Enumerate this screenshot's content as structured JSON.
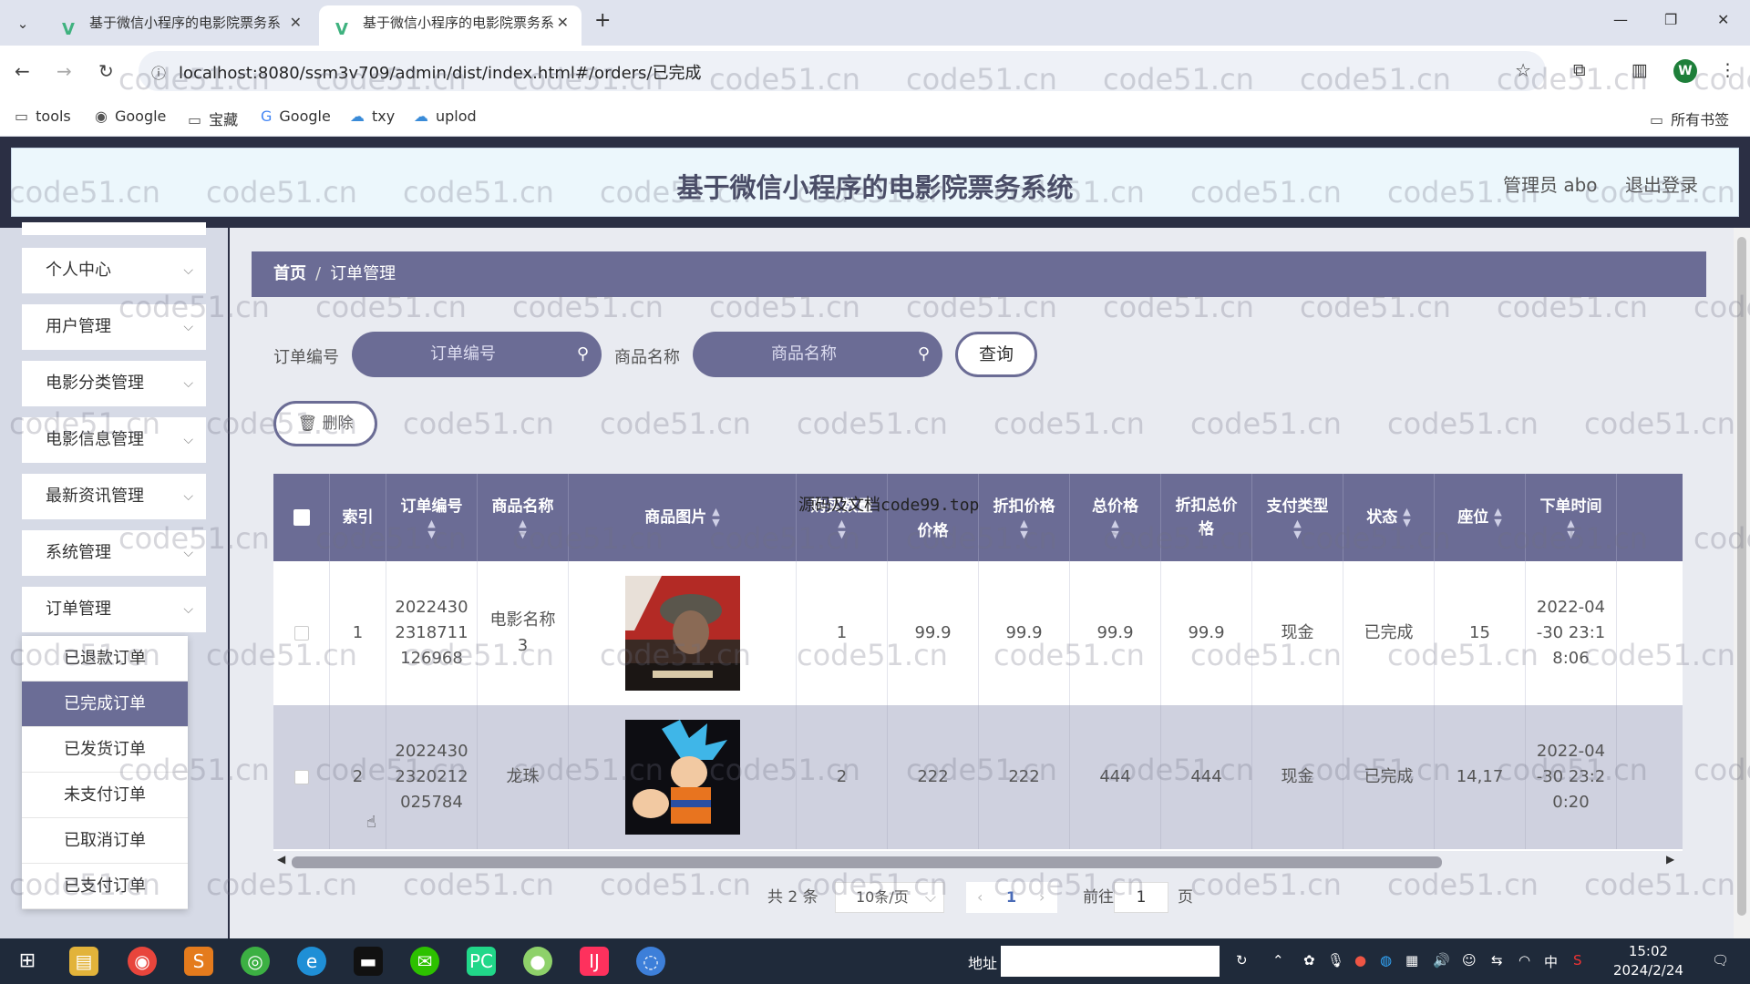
{
  "browser": {
    "tabs": [
      {
        "label": "基于微信小程序的电影院票务系",
        "active": false
      },
      {
        "label": "基于微信小程序的电影院票务系",
        "active": true
      }
    ],
    "url": "localhost:8080/ssm3v709/admin/dist/index.html#/orders/已完成",
    "profile_letter": "W",
    "bookmarks": [
      "tools",
      "Google",
      "宝藏",
      "Google",
      "txy",
      "uplod"
    ],
    "all_bookmarks": "所有书签"
  },
  "header": {
    "title": "基于微信小程序的电影院票务系统",
    "admin": "管理员 abo",
    "logout": "退出登录"
  },
  "sidebar": {
    "items": [
      "个人中心",
      "用户管理",
      "电影分类管理",
      "电影信息管理",
      "最新资讯管理",
      "系统管理",
      "订单管理"
    ],
    "submenu": [
      "已退款订单",
      "已完成订单",
      "已发货订单",
      "未支付订单",
      "已取消订单",
      "已支付订单"
    ],
    "active_sub": "已完成订单"
  },
  "breadcrumb": {
    "home": "首页",
    "current": "订单管理"
  },
  "search": {
    "order_label": "订单编号",
    "order_placeholder": "订单编号",
    "product_label": "商品名称",
    "product_placeholder": "商品名称",
    "query": "查询",
    "delete": "删除"
  },
  "table": {
    "headers": [
      "索引",
      "订单编号",
      "商品名称",
      "商品图片",
      "购买数量",
      "价格",
      "折扣价格",
      "总价格",
      "折扣总价格",
      "支付类型",
      "状态",
      "座位",
      "下单时间"
    ],
    "rows": [
      {
        "index": "1",
        "order_no": "2022430\n2318711\n126968",
        "name": "电影名称\n3",
        "qty": "1",
        "price": "99.9",
        "discount_price": "99.9",
        "total": "99.9",
        "discount_total": "99.9",
        "pay_type": "现金",
        "status": "已完成",
        "seat": "15",
        "time": "2022-04\n-30 23:1\n8:06"
      },
      {
        "index": "2",
        "order_no": "2022430\n2320212\n025784",
        "name": "龙珠",
        "qty": "2",
        "price": "222",
        "discount_price": "222",
        "total": "444",
        "discount_total": "444",
        "pay_type": "现金",
        "status": "已完成",
        "seat": "14,17",
        "time": "2022-04\n-30 23:2\n0:20"
      }
    ]
  },
  "pagination": {
    "total": "共 2 条",
    "page_size": "10条/页",
    "current": "1",
    "goto_prefix": "前往",
    "goto_value": "1",
    "goto_suffix": "页"
  },
  "overlay_text": "源码及文档code99.top",
  "watermark": "code51.cn",
  "taskbar": {
    "address_label": "地址",
    "time": "15:02",
    "date": "2024/2/24",
    "ime": "中"
  }
}
